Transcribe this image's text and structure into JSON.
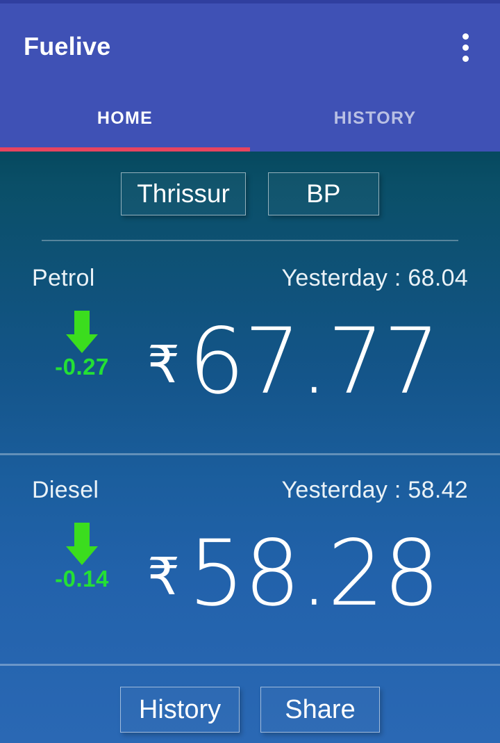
{
  "app": {
    "title": "Fuelive",
    "overflow_icon": "more-vertical-icon"
  },
  "tabs": [
    {
      "label": "HOME",
      "active": true
    },
    {
      "label": "HISTORY",
      "active": false
    }
  ],
  "selectors": [
    {
      "name": "city",
      "label": "Thrissur"
    },
    {
      "name": "brand",
      "label": "BP"
    }
  ],
  "fuels": [
    {
      "name": "Petrol",
      "yesterday_label": "Yesterday : 68.04",
      "yesterday_value": "68.04",
      "currency": "₹",
      "price": "67.77",
      "delta": "-0.27",
      "trend": "down",
      "trend_icon": "arrow-down-icon"
    },
    {
      "name": "Diesel",
      "yesterday_label": "Yesterday : 58.42",
      "yesterday_value": "58.42",
      "currency": "₹",
      "price": "58.28",
      "delta": "-0.14",
      "trend": "down",
      "trend_icon": "arrow-down-icon"
    }
  ],
  "actions": [
    {
      "name": "history",
      "label": "History"
    },
    {
      "name": "share",
      "label": "Share"
    }
  ],
  "colors": {
    "appbar": "#3f51b5",
    "status_strip": "#303f9f",
    "tab_indicator": "#e8445f",
    "content_top": "#06495f",
    "content_bottom": "#2a68b4",
    "trend_down": "#24e035",
    "arrow": "#3bdd1e",
    "text": "#ffffff"
  }
}
